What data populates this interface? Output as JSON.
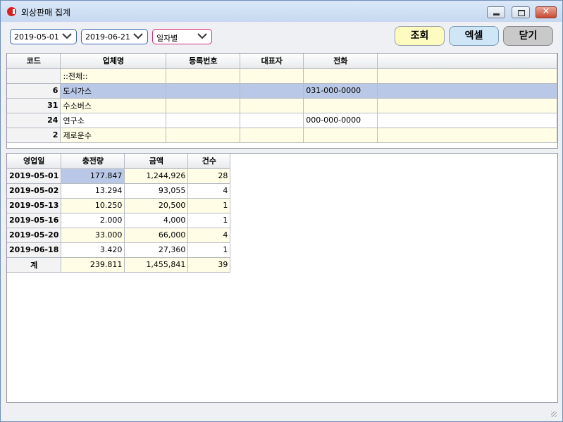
{
  "window": {
    "title": "외상판매 집계"
  },
  "toolbar": {
    "start_date": "2019-05-01",
    "end_date": "2019-06-21",
    "mode": "일자별",
    "search_label": "조회",
    "excel_label": "엑셀",
    "close_label": "닫기"
  },
  "vendors": {
    "headers": [
      "코드",
      "업체명",
      "등록번호",
      "대표자",
      "전화"
    ],
    "rows": [
      {
        "code": "",
        "name": "::전체::",
        "reg": "",
        "rep": "",
        "phone": ""
      },
      {
        "code": "6",
        "name": "도시가스",
        "reg": "",
        "rep": "",
        "phone": "031-000-0000"
      },
      {
        "code": "31",
        "name": "수소버스",
        "reg": "",
        "rep": "",
        "phone": ""
      },
      {
        "code": "24",
        "name": "연구소",
        "reg": "",
        "rep": "",
        "phone": "000-000-0000"
      },
      {
        "code": "2",
        "name": "제로운수",
        "reg": "",
        "rep": "",
        "phone": ""
      }
    ]
  },
  "summary": {
    "headers": [
      "영업일",
      "충전량",
      "금액",
      "건수"
    ],
    "rows": [
      {
        "date": "2019-05-01",
        "qty": "177.847",
        "amount": "1,244,926",
        "count": "28"
      },
      {
        "date": "2019-05-02",
        "qty": "13.294",
        "amount": "93,055",
        "count": "4"
      },
      {
        "date": "2019-05-13",
        "qty": "10.250",
        "amount": "20,500",
        "count": "1"
      },
      {
        "date": "2019-05-16",
        "qty": "2.000",
        "amount": "4,000",
        "count": "1"
      },
      {
        "date": "2019-05-20",
        "qty": "33.000",
        "amount": "66,000",
        "count": "4"
      },
      {
        "date": "2019-06-18",
        "qty": "3.420",
        "amount": "27,360",
        "count": "1"
      }
    ],
    "total": {
      "label": "계",
      "qty": "239.811",
      "amount": "1,455,841",
      "count": "39"
    }
  },
  "colors": {
    "selected": "#b8c8e6",
    "row_alt": "#fffde6",
    "search_button": "#fdfbc0",
    "excel_button": "#cfe6f7",
    "close_button": "#c9c9c9"
  },
  "icons": {
    "app": "app-logo-icon",
    "dropdown": "chevron-down-icon"
  }
}
